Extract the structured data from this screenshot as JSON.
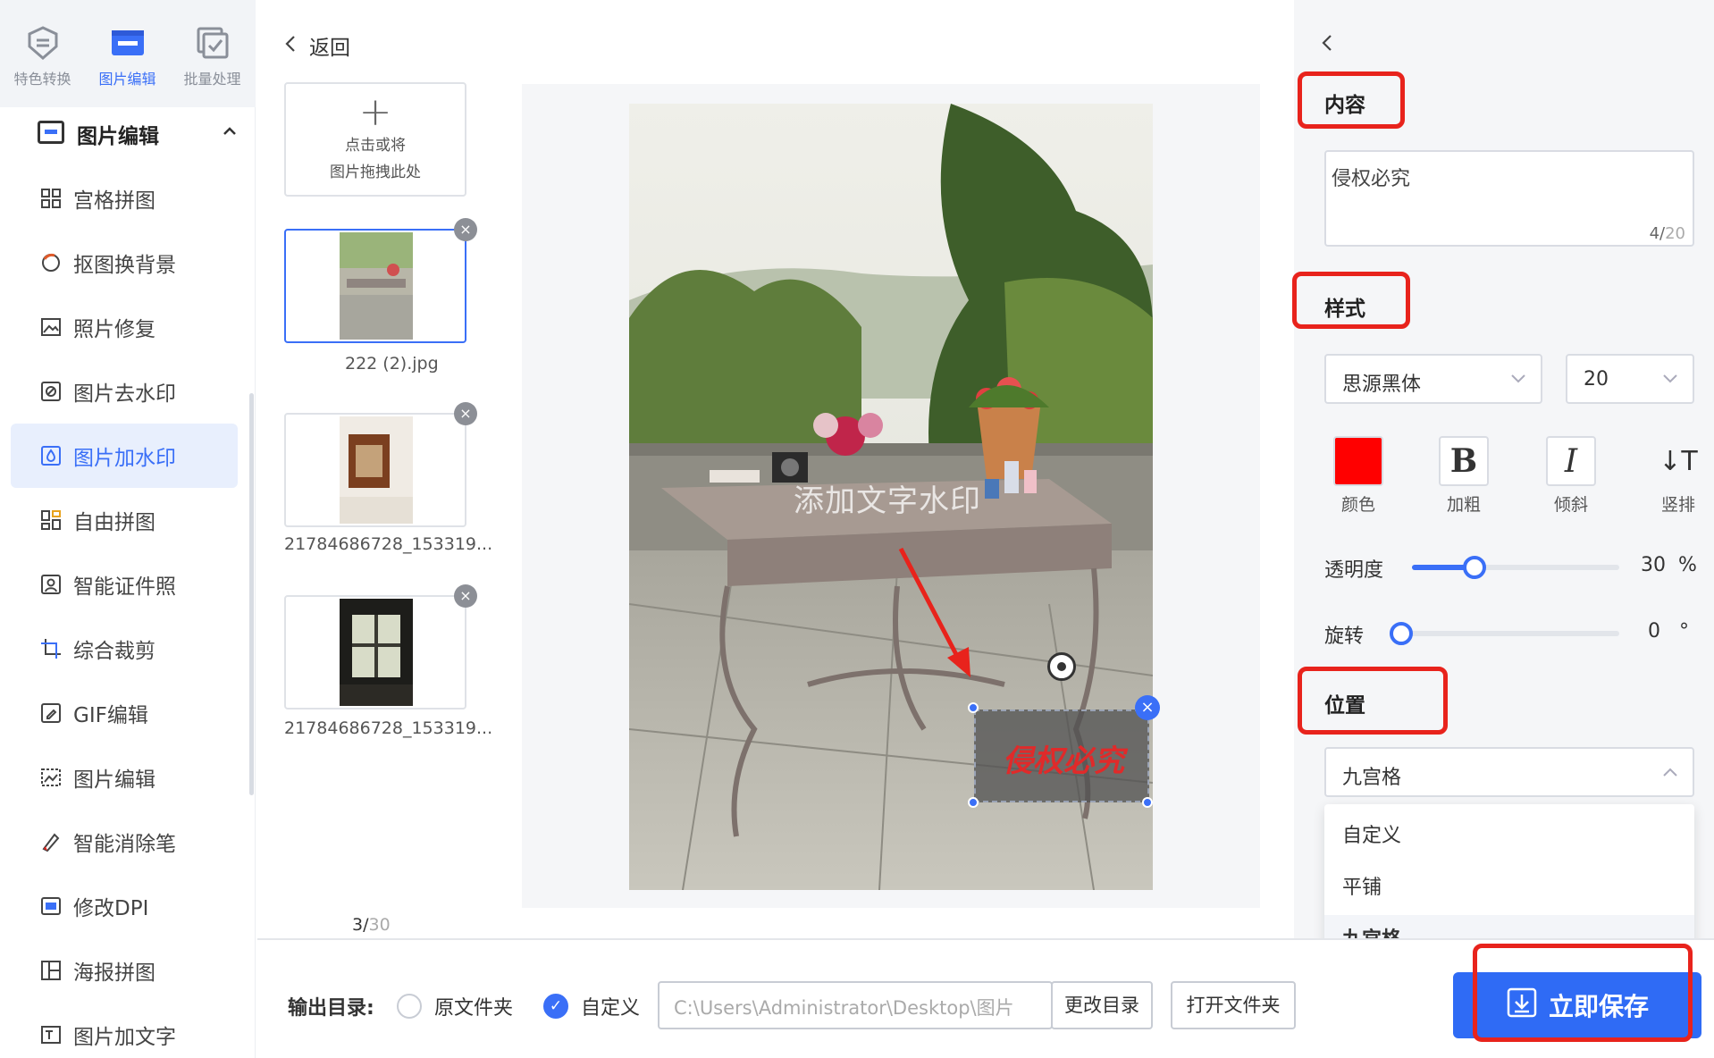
{
  "sidebar": {
    "top_tabs": [
      {
        "label": "特色转换",
        "icon": "shield-icon"
      },
      {
        "label": "图片编辑",
        "icon": "image-edit-icon"
      },
      {
        "label": "批量处理",
        "icon": "batch-icon"
      }
    ],
    "section_title": "图片编辑",
    "items": [
      {
        "label": "宫格拼图",
        "icon": "grid-icon"
      },
      {
        "label": "抠图换背景",
        "icon": "cutout-icon"
      },
      {
        "label": "照片修复",
        "icon": "photo-repair-icon"
      },
      {
        "label": "图片去水印",
        "icon": "remove-watermark-icon"
      },
      {
        "label": "图片加水印",
        "icon": "add-watermark-icon"
      },
      {
        "label": "自由拼图",
        "icon": "collage-icon"
      },
      {
        "label": "智能证件照",
        "icon": "id-photo-icon"
      },
      {
        "label": "综合裁剪",
        "icon": "crop-icon"
      },
      {
        "label": "GIF编辑",
        "icon": "gif-icon"
      },
      {
        "label": "图片编辑",
        "icon": "image-icon"
      },
      {
        "label": "智能消除笔",
        "icon": "eraser-pen-icon"
      },
      {
        "label": "修改DPI",
        "icon": "dpi-icon"
      },
      {
        "label": "海报拼图",
        "icon": "poster-icon"
      },
      {
        "label": "图片加文字",
        "icon": "add-text-icon"
      }
    ],
    "active_item": "图片加水印"
  },
  "middle": {
    "back_label": "返回",
    "upload_line1": "点击或将",
    "upload_line2": "图片拖拽此处",
    "files": [
      {
        "name": "222 (2).jpg"
      },
      {
        "name": "21784686728_153319..."
      },
      {
        "name": "21784686728_153319..."
      }
    ],
    "page_current": "3/",
    "page_total": "30",
    "watermark_preview_text": "添加文字水印",
    "watermark_box_text": "侵权必究"
  },
  "panel": {
    "content_title": "内容",
    "content_value": "侵权必究",
    "content_count": "4/",
    "content_max": "20",
    "style_title": "样式",
    "font_family": "思源黑体",
    "font_size": "20",
    "style_buttons": [
      {
        "label": "颜色",
        "glyph": ""
      },
      {
        "label": "加粗",
        "glyph": "B"
      },
      {
        "label": "倾斜",
        "glyph": "I"
      },
      {
        "label": "竖排",
        "glyph": "↓T"
      }
    ],
    "color_value": "#ff0000",
    "opacity_label": "透明度",
    "opacity_value": "30",
    "opacity_unit": "%",
    "opacity_fraction": 0.3,
    "rotate_label": "旋转",
    "rotate_value": "0",
    "rotate_unit": "°",
    "rotate_fraction": 0.0,
    "position_title": "位置",
    "position_value": "九宫格",
    "position_options": [
      "自定义",
      "平铺",
      "九宫格"
    ]
  },
  "bottom": {
    "output_label": "输出目录:",
    "option_original": "原文件夹",
    "option_custom": "自定义",
    "path": "C:\\Users\\Administrator\\Desktop\\图片",
    "change_dir": "更改目录",
    "open_folder": "打开文件夹",
    "save": "立即保存"
  },
  "colors": {
    "accent": "#3a6ff7",
    "highlight_box": "#e8231c",
    "watermark_text": "#e02a2a"
  }
}
